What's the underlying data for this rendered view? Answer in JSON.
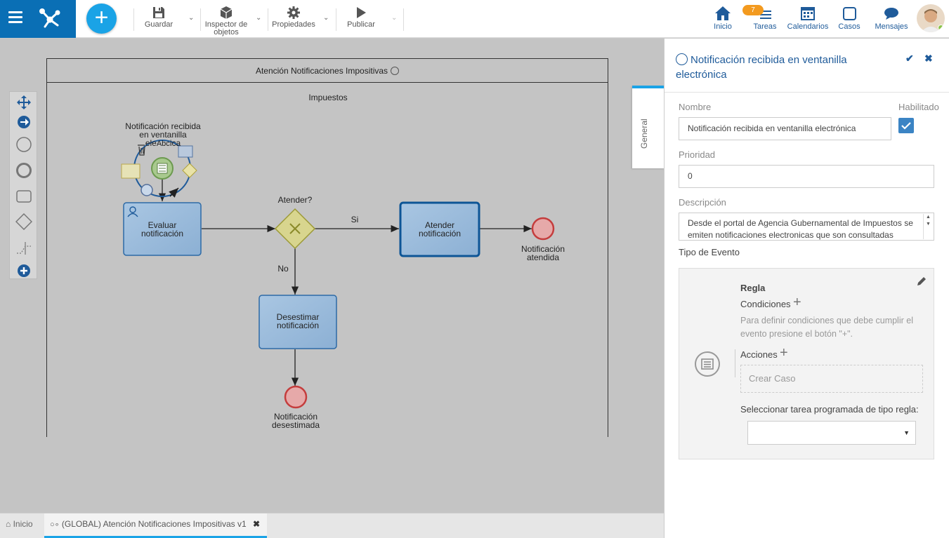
{
  "toolbar": {
    "guardar": "Guardar",
    "inspector_line1": "Inspector de",
    "inspector_line2": "objetos",
    "propiedades": "Propiedades",
    "publicar": "Publicar"
  },
  "nav": {
    "inicio": "Inicio",
    "tareas": "Tareas",
    "tareas_count": "7",
    "calendarios": "Calendarios",
    "casos": "Casos",
    "mensajes": "Mensajes"
  },
  "diagram": {
    "pool_title": "Atención Notificaciones Impositivas",
    "lane_title": "Impuestos",
    "start_label_1": "Notificación recibida",
    "start_label_2": "en ventanilla",
    "start_label_3": "ele",
    "start_label_3b": "Abc",
    "start_label_3c": "ica",
    "task_evaluar_1": "Evaluar",
    "task_evaluar_2": "notificación",
    "gateway_label": "Atender?",
    "flow_si": "Si",
    "flow_no": "No",
    "task_atender_1": "Atender",
    "task_atender_2": "notificación",
    "end_atendida_1": "Notificación",
    "end_atendida_2": "atendida",
    "task_desestimar_1": "Desestimar",
    "task_desestimar_2": "notificación",
    "end_desestimada_1": "Notificación",
    "end_desestimada_2": "desestimada"
  },
  "bottom_tabs": {
    "home": "Inicio",
    "process": "(GLOBAL) Atención Notificaciones Impositivas v1"
  },
  "panel": {
    "title": "Notificación recibida en ventanilla electrónica",
    "vertical_tab": "General",
    "nombre_label": "Nombre",
    "nombre_value": "Notificación recibida en ventanilla electrónica",
    "habilitado_label": "Habilitado",
    "prioridad_label": "Prioridad",
    "prioridad_value": "0",
    "descripcion_label": "Descripción",
    "descripcion_value": "Desde el portal de Agencia Gubernamental de Impuestos se emiten notificaciones electronicas que son consultadas",
    "tipo_evento_label": "Tipo de Evento",
    "regla_label": "Regla",
    "condiciones_label": "Condiciones",
    "condiciones_help_1": "Para definir condiciones que debe cumplir el",
    "condiciones_help_2": "evento presione el botón \"+\".",
    "acciones_label": "Acciones",
    "crear_caso": "Crear Caso",
    "tarea_programada_label": "Seleccionar tarea programada de tipo regla:",
    "tarea_programada_value": ""
  },
  "colors": {
    "brand": "#0a6fb5",
    "accent": "#1aa3e6",
    "link": "#1f5b9a",
    "badge": "#f39a1f"
  }
}
